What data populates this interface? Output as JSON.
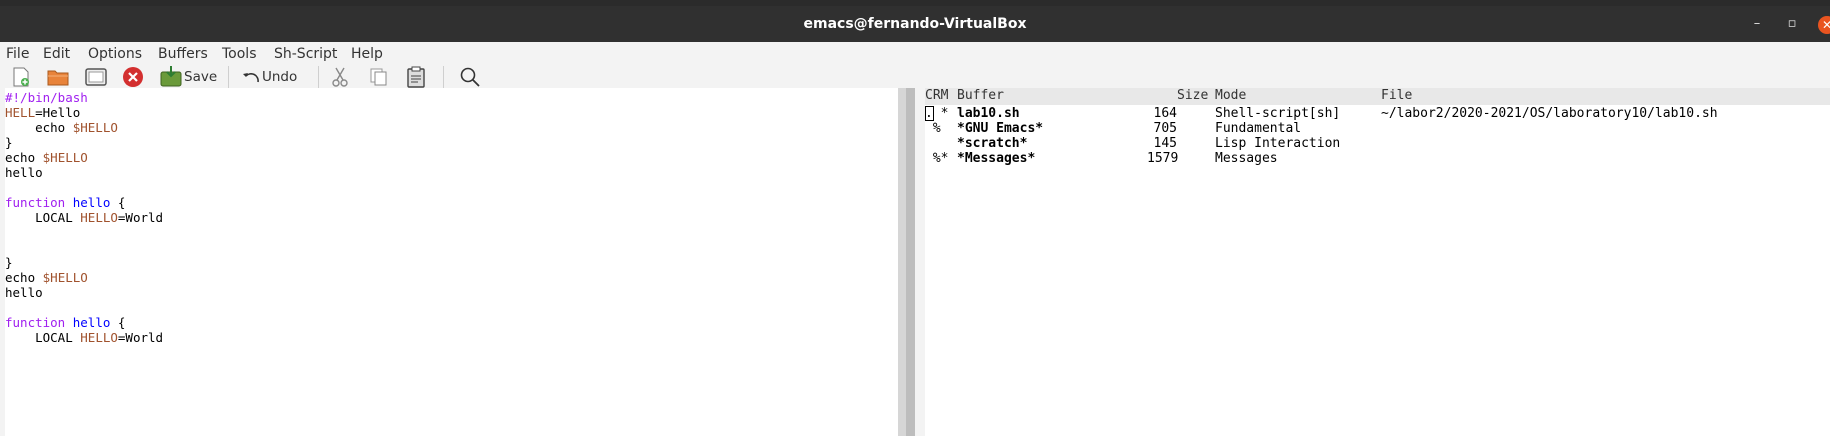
{
  "window": {
    "title": "emacs@fernando-VirtualBox"
  },
  "menu": [
    "File",
    "Edit",
    "Options",
    "Buffers",
    "Tools",
    "Sh-Script",
    "Help"
  ],
  "toolbar": {
    "new_file": "new-file-icon",
    "open_file": "open-folder-icon",
    "dired": "directory-icon",
    "close": "close-icon",
    "save_label": "Save",
    "undo_label": "Undo",
    "cut": "scissors-icon",
    "copy": "copy-icon",
    "paste": "paste-icon",
    "search": "search-icon"
  },
  "editor": {
    "lines": [
      [
        [
          "#!/bin/bash",
          "kw"
        ]
      ],
      [
        [
          "HELL",
          "var"
        ],
        [
          "=Hello",
          ""
        ]
      ],
      [
        [
          "    echo ",
          ""
        ],
        [
          "$HELLO",
          "var"
        ]
      ],
      [
        [
          "}",
          ""
        ]
      ],
      [
        [
          "echo ",
          ""
        ],
        [
          "$HELLO",
          "var"
        ]
      ],
      [
        [
          "hello",
          ""
        ]
      ],
      [
        [
          "",
          ""
        ]
      ],
      [
        [
          "function",
          "kw"
        ],
        [
          " ",
          ""
        ],
        [
          "hello",
          "fn"
        ],
        [
          " {",
          ""
        ]
      ],
      [
        [
          "    LOCAL ",
          ""
        ],
        [
          "HELLO",
          "var"
        ],
        [
          "=World",
          ""
        ]
      ],
      [
        [
          "",
          ""
        ]
      ],
      [
        [
          "",
          ""
        ]
      ],
      [
        [
          "}",
          ""
        ]
      ],
      [
        [
          "echo ",
          ""
        ],
        [
          "$HELLO",
          "var"
        ]
      ],
      [
        [
          "hello",
          ""
        ]
      ],
      [
        [
          "",
          ""
        ]
      ],
      [
        [
          "function",
          "kw"
        ],
        [
          " ",
          ""
        ],
        [
          "hello",
          "fn"
        ],
        [
          " {",
          ""
        ]
      ],
      [
        [
          "    LOCAL ",
          ""
        ],
        [
          "HELLO",
          "var"
        ],
        [
          "=World",
          ""
        ]
      ]
    ]
  },
  "buffer_list": {
    "headers": {
      "crm": "CRM",
      "buffer": "Buffer",
      "size": "Size",
      "mode": "Mode",
      "file": "File"
    },
    "rows": [
      {
        "crm": ". *",
        "buffer": "lab10.sh",
        "size": "164",
        "mode": "Shell-script[sh]",
        "file": "~/labor2/2020-2021/OS/laboratory10/lab10.sh"
      },
      {
        "crm": " %",
        "buffer": "*GNU Emacs*",
        "size": "705",
        "mode": "Fundamental",
        "file": ""
      },
      {
        "crm": "",
        "buffer": "*scratch*",
        "size": "145",
        "mode": "Lisp Interaction",
        "file": ""
      },
      {
        "crm": " %*",
        "buffer": "*Messages*",
        "size": "1579",
        "mode": "Messages",
        "file": ""
      }
    ]
  },
  "colors": {
    "keyword": "#a020f0",
    "function": "#0000ff",
    "variable": "#a0522d",
    "close_button": "#e95420"
  }
}
